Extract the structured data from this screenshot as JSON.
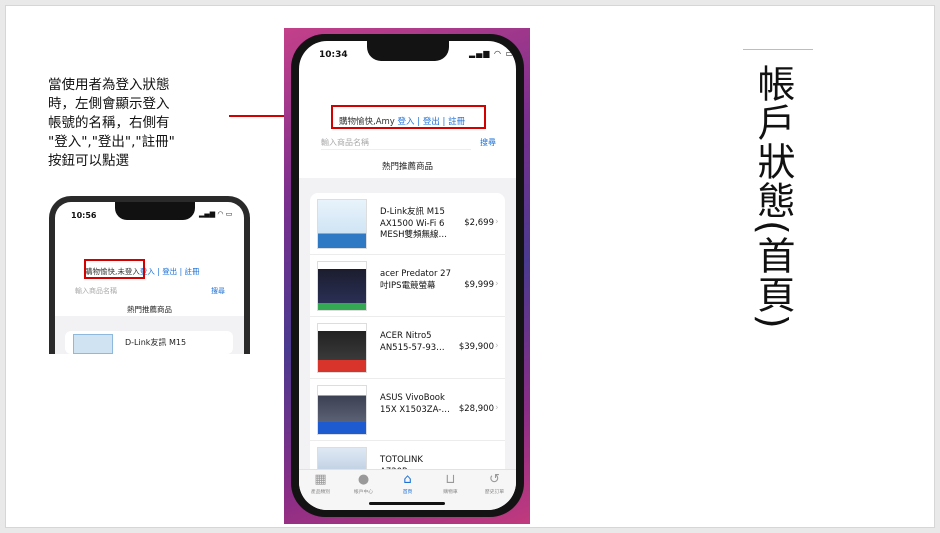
{
  "annotation_text": "當使用者為登入狀態\n時，左側會顯示登入\n帳號的名稱，右側有\n\"登入\",\"登出\",\"註冊\"\n按鈕可以點選",
  "slide_title": "帳戶狀態(首頁)",
  "small_screenshot": {
    "time": "10:56",
    "status_icons": "▂▄▆ ◠ ▭",
    "account_name": "購物愉快,未登入",
    "login": "登入",
    "sep1": " | ",
    "logout": "登出",
    "sep2": " | ",
    "register": "註冊",
    "search_placeholder": "輸入商品名稱",
    "search_button": "搜尋",
    "section_title": "熱門推薦商品",
    "first_item": "D-Link友訊 M15"
  },
  "phone": {
    "time": "10:34",
    "status_icons": "▂▄▆ ◠ ▭",
    "account_name": "購物愉快,Amy",
    "login": "登入",
    "sep1": " | ",
    "logout": "登出",
    "sep2": " | ",
    "register": "註冊",
    "search_placeholder": "輸入商品名稱",
    "search_button": "搜尋",
    "section_title": "熱門推薦商品",
    "products": [
      {
        "name": "D-Link友訊 M15 AX1500 Wi-Fi 6 MESH雙頻無線…",
        "price": "$2,699"
      },
      {
        "name": "acer Predator 27吋IPS電競螢幕",
        "price": "$9,999"
      },
      {
        "name": "ACER Nitro5 AN515-57-93…",
        "price": "$39,900"
      },
      {
        "name": "ASUS VivoBook 15X X1503ZA-…",
        "price": "$28,900"
      },
      {
        "name": "TOTOLINK A720R",
        "price": ""
      }
    ],
    "tabs": [
      {
        "label": "產品類別",
        "icon": "▦"
      },
      {
        "label": "帳戶中心",
        "icon": "●"
      },
      {
        "label": "首頁",
        "icon": "⌂"
      },
      {
        "label": "購物車",
        "icon": "⊔"
      },
      {
        "label": "歷史訂單",
        "icon": "↺"
      }
    ]
  },
  "colors": {
    "highlight_red": "#d40000",
    "link_blue": "#1a6fd8"
  }
}
